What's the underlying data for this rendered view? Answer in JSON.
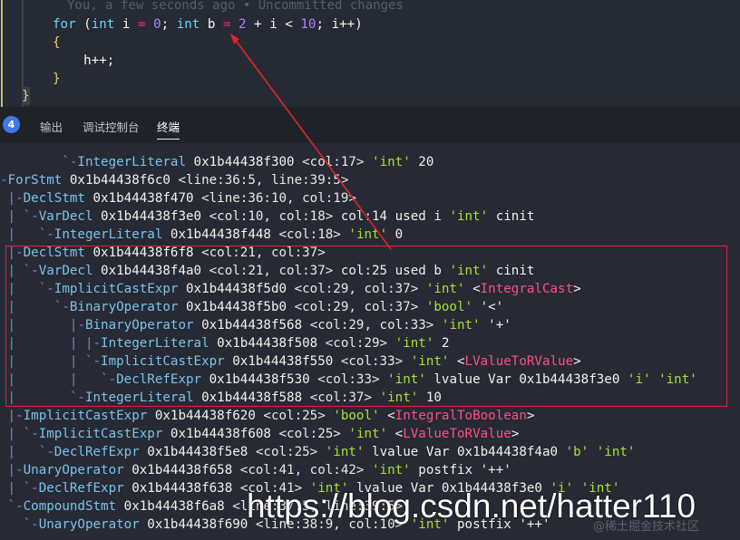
{
  "colors": {
    "accent": "#3e7ae6",
    "highlight_box": "#e0242a",
    "arrow": "#e0242a",
    "terminal_bg": "#272a35"
  },
  "editor": {
    "blame": "You, a few seconds ago • Uncommitted changes",
    "lines": [
      [
        {
          "t": "for",
          "c": "kw"
        },
        {
          "t": " (",
          "c": "p"
        },
        {
          "t": "int",
          "c": "kw"
        },
        {
          "t": " i ",
          "c": "id"
        },
        {
          "t": "=",
          "c": "op"
        },
        {
          "t": " ",
          "c": "p"
        },
        {
          "t": "0",
          "c": "num"
        },
        {
          "t": "; ",
          "c": "p"
        },
        {
          "t": "int",
          "c": "kw"
        },
        {
          "t": " b ",
          "c": "id"
        },
        {
          "t": "=",
          "c": "op"
        },
        {
          "t": " ",
          "c": "p"
        },
        {
          "t": "2",
          "c": "num"
        },
        {
          "t": " + i < ",
          "c": "id"
        },
        {
          "t": "10",
          "c": "num"
        },
        {
          "t": "; i++)",
          "c": "id"
        }
      ],
      [
        {
          "t": "{",
          "c": "brace"
        }
      ],
      [
        {
          "t": "    h++;",
          "c": "id"
        }
      ],
      [
        {
          "t": "}",
          "c": "brace"
        }
      ]
    ],
    "last_brace": "}"
  },
  "panel": {
    "badge": "4",
    "tabs": [
      {
        "label": "输出",
        "active": false
      },
      {
        "label": "调试控制台",
        "active": false
      },
      {
        "label": "终端",
        "active": true
      }
    ]
  },
  "terminal": {
    "lines": [
      [
        [
          "        `-",
          "t"
        ],
        [
          "IntegerLiteral",
          "n"
        ],
        [
          " 0x1b44438f300 ",
          "p"
        ],
        [
          "<col:17>",
          "l"
        ],
        [
          " ",
          "p"
        ],
        [
          "'int'",
          "s"
        ],
        [
          " 20",
          "p"
        ]
      ],
      [
        [
          "-",
          "t"
        ],
        [
          "ForStmt",
          "n"
        ],
        [
          " 0x1b44438f6c0 ",
          "p"
        ],
        [
          "<line:36:5, line:39:5>",
          "l"
        ]
      ],
      [
        [
          " |-",
          "t"
        ],
        [
          "DeclStmt",
          "n"
        ],
        [
          " 0x1b44438f470 ",
          "p"
        ],
        [
          "<line:36:10, col:19>",
          "l"
        ]
      ],
      [
        [
          " | `-",
          "t"
        ],
        [
          "VarDecl",
          "n"
        ],
        [
          " 0x1b44438f3e0 ",
          "p"
        ],
        [
          "<col:10, col:18>",
          "l"
        ],
        [
          " col:14 used i ",
          "p"
        ],
        [
          "'int'",
          "s"
        ],
        [
          " cinit",
          "p"
        ]
      ],
      [
        [
          " |   `-",
          "t"
        ],
        [
          "IntegerLiteral",
          "n"
        ],
        [
          " 0x1b44438f448 ",
          "p"
        ],
        [
          "<col:18>",
          "l"
        ],
        [
          " ",
          "p"
        ],
        [
          "'int'",
          "s"
        ],
        [
          " 0",
          "p"
        ]
      ],
      [
        [
          " |-",
          "t"
        ],
        [
          "DeclStmt",
          "n"
        ],
        [
          " 0x1b44438f6f8 ",
          "p"
        ],
        [
          "<col:21, col:37>",
          "l"
        ]
      ],
      [
        [
          " | `-",
          "t"
        ],
        [
          "VarDecl",
          "n"
        ],
        [
          " 0x1b44438f4a0 ",
          "p"
        ],
        [
          "<col:21, col:37>",
          "l"
        ],
        [
          " col:25 used b ",
          "p"
        ],
        [
          "'int'",
          "s"
        ],
        [
          " cinit",
          "p"
        ]
      ],
      [
        [
          " |   `-",
          "t"
        ],
        [
          "ImplicitCastExpr",
          "n"
        ],
        [
          " 0x1b44438f5d0 ",
          "p"
        ],
        [
          "<col:29, col:37>",
          "l"
        ],
        [
          " ",
          "p"
        ],
        [
          "'int'",
          "s"
        ],
        [
          " <",
          "p"
        ],
        [
          "IntegralCast",
          "k"
        ],
        [
          ">",
          "p"
        ]
      ],
      [
        [
          " |     `-",
          "t"
        ],
        [
          "BinaryOperator",
          "n"
        ],
        [
          " 0x1b44438f5b0 ",
          "p"
        ],
        [
          "<col:29, col:37>",
          "l"
        ],
        [
          " ",
          "p"
        ],
        [
          "'bool'",
          "s"
        ],
        [
          " '<'",
          "p"
        ]
      ],
      [
        [
          " |       |-",
          "t"
        ],
        [
          "BinaryOperator",
          "n"
        ],
        [
          " 0x1b44438f568 ",
          "p"
        ],
        [
          "<col:29, col:33>",
          "l"
        ],
        [
          " ",
          "p"
        ],
        [
          "'int'",
          "s"
        ],
        [
          " '+'",
          "p"
        ]
      ],
      [
        [
          " |       | |-",
          "t"
        ],
        [
          "IntegerLiteral",
          "n"
        ],
        [
          " 0x1b44438f508 ",
          "p"
        ],
        [
          "<col:29>",
          "l"
        ],
        [
          " ",
          "p"
        ],
        [
          "'int'",
          "s"
        ],
        [
          " 2",
          "p"
        ]
      ],
      [
        [
          " |       | `-",
          "t"
        ],
        [
          "ImplicitCastExpr",
          "n"
        ],
        [
          " 0x1b44438f550 ",
          "p"
        ],
        [
          "<col:33>",
          "l"
        ],
        [
          " ",
          "p"
        ],
        [
          "'int'",
          "s"
        ],
        [
          " <",
          "p"
        ],
        [
          "LValueToRValue",
          "k"
        ],
        [
          ">",
          "p"
        ]
      ],
      [
        [
          " |       |   `-",
          "t"
        ],
        [
          "DeclRefExpr",
          "n"
        ],
        [
          " 0x1b44438f530 ",
          "p"
        ],
        [
          "<col:33>",
          "l"
        ],
        [
          " ",
          "p"
        ],
        [
          "'int'",
          "s"
        ],
        [
          " lvalue Var 0x1b44438f3e0 ",
          "p"
        ],
        [
          "'i'",
          "s"
        ],
        [
          " ",
          "p"
        ],
        [
          "'int'",
          "s"
        ]
      ],
      [
        [
          " |       `-",
          "t"
        ],
        [
          "IntegerLiteral",
          "n"
        ],
        [
          " 0x1b44438f588 ",
          "p"
        ],
        [
          "<col:37>",
          "l"
        ],
        [
          " ",
          "p"
        ],
        [
          "'int'",
          "s"
        ],
        [
          " 10",
          "p"
        ]
      ],
      [
        [
          " |-",
          "t"
        ],
        [
          "ImplicitCastExpr",
          "n"
        ],
        [
          " 0x1b44438f620 ",
          "p"
        ],
        [
          "<col:25>",
          "l"
        ],
        [
          " ",
          "p"
        ],
        [
          "'bool'",
          "s"
        ],
        [
          " <",
          "p"
        ],
        [
          "IntegralToBoolean",
          "k"
        ],
        [
          ">",
          "p"
        ]
      ],
      [
        [
          " | `-",
          "t"
        ],
        [
          "ImplicitCastExpr",
          "n"
        ],
        [
          " 0x1b44438f608 ",
          "p"
        ],
        [
          "<col:25>",
          "l"
        ],
        [
          " ",
          "p"
        ],
        [
          "'int'",
          "s"
        ],
        [
          " <",
          "p"
        ],
        [
          "LValueToRValue",
          "k"
        ],
        [
          ">",
          "p"
        ]
      ],
      [
        [
          " |   `-",
          "t"
        ],
        [
          "DeclRefExpr",
          "n"
        ],
        [
          " 0x1b44438f5e8 ",
          "p"
        ],
        [
          "<col:25>",
          "l"
        ],
        [
          " ",
          "p"
        ],
        [
          "'int'",
          "s"
        ],
        [
          " lvalue Var 0x1b44438f4a0 ",
          "p"
        ],
        [
          "'b'",
          "s"
        ],
        [
          " ",
          "p"
        ],
        [
          "'int'",
          "s"
        ]
      ],
      [
        [
          " |-",
          "t"
        ],
        [
          "UnaryOperator",
          "n"
        ],
        [
          " 0x1b44438f658 ",
          "p"
        ],
        [
          "<col:41, col:42>",
          "l"
        ],
        [
          " ",
          "p"
        ],
        [
          "'int'",
          "s"
        ],
        [
          " postfix '++'",
          "p"
        ]
      ],
      [
        [
          " | `-",
          "t"
        ],
        [
          "DeclRefExpr",
          "n"
        ],
        [
          " 0x1b44438f638 ",
          "p"
        ],
        [
          "<col:41>",
          "l"
        ],
        [
          " ",
          "p"
        ],
        [
          "'int'",
          "s"
        ],
        [
          " lvalue Var 0x1b44438f3e0 ",
          "p"
        ],
        [
          "'i'",
          "s"
        ],
        [
          " ",
          "p"
        ],
        [
          "'int'",
          "s"
        ]
      ],
      [
        [
          " `-",
          "t"
        ],
        [
          "CompoundStmt",
          "n"
        ],
        [
          " 0x1b44438f6a8 ",
          "p"
        ],
        [
          "<line:37:5, line:39:5>",
          "l"
        ]
      ],
      [
        [
          "   `-",
          "t"
        ],
        [
          "UnaryOperator",
          "n"
        ],
        [
          " 0x1b44438f690 ",
          "p"
        ],
        [
          "<line:38:9, col:10>",
          "l"
        ],
        [
          " ",
          "p"
        ],
        [
          "'int'",
          "s"
        ],
        [
          " postfix '++'",
          "p"
        ]
      ]
    ]
  },
  "watermark": "https://blog.csdn.net/hatter110",
  "corner_mark": "@稀土掘金技术社区"
}
